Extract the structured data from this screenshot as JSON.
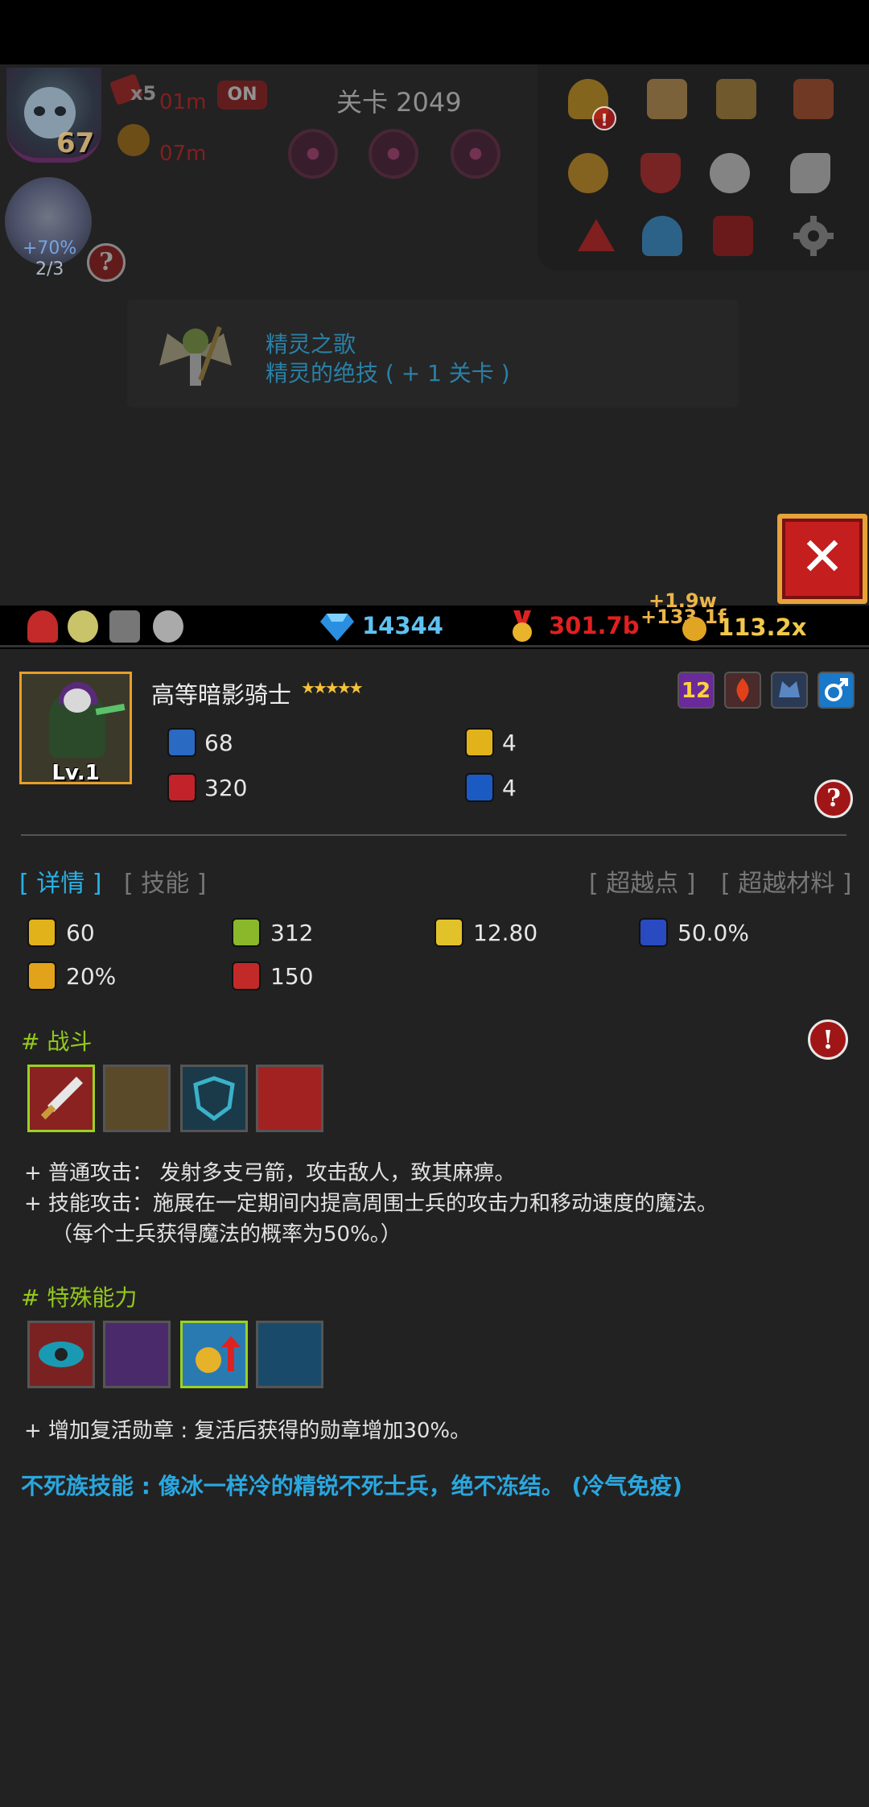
{
  "hud": {
    "hero_level": "67",
    "pet_bonus": "+70%",
    "pet_count": "2/3",
    "multiplier_badge": "x5",
    "timer_1": "01m",
    "timer_2": "07m",
    "on_label": "ON",
    "stage_label": "关卡 2049",
    "help_glyph": "?",
    "alert_glyph": "!"
  },
  "right_menu": {
    "icons": [
      "trophy-icon",
      "podium-icon",
      "book-icon",
      "scroll-icon",
      "chat-icon",
      "shield-crest-icon",
      "angel-icon",
      "bird-icon",
      "triangle-icon",
      "friends-icon",
      "shrine-icon",
      "gear-icon"
    ]
  },
  "notice": {
    "line1": "精灵之歌",
    "line2": "精灵的绝技 ( + 1 关卡 )"
  },
  "close_glyph": "✕",
  "resources": {
    "gems": "14344",
    "medals": "301.7b",
    "float_1": "+1.9w",
    "float_2": "+133.1f",
    "multiplier": "113.2x"
  },
  "unit": {
    "name": "高等暗影骑士",
    "stars": "★★★★★",
    "level": "Lv.1",
    "tag_number": "12",
    "attack": "68",
    "hp": "320",
    "defense": "4",
    "magic_defense": "4"
  },
  "tabs": {
    "details": "[ 详情 ]",
    "skills": "[ 技能 ]",
    "transcend_points": "[ 超越点 ]",
    "transcend_materials": "[ 超越材料 ]"
  },
  "stats": {
    "s1": "60",
    "s2": "312",
    "s3": "12.80",
    "s4": "50.0%",
    "s5": "20%",
    "s6": "150"
  },
  "combat": {
    "title": "# 战斗",
    "desc1": "+ 普通攻击： 发射多支弓箭，攻击敌人，致其麻痹。",
    "desc2": "+ 技能攻击：施展在一定期间内提高周围士兵的攻击力和移动速度的魔法。",
    "desc3": "（每个士兵获得魔法的概率为50%。）"
  },
  "special": {
    "title": "# 特殊能力",
    "desc1": "+ 增加复活勋章 : 复活后获得的勋章增加30%。"
  },
  "undead_skill": "不死族技能 : 像冰一样冷的精锐不死士兵，绝不冻结。 (冷气免疫)",
  "colors": {
    "accent_blue": "#29b1e6",
    "section_green": "#94c81c",
    "gem_blue": "#5ec2f2",
    "medal_red": "#e21f1f",
    "close_red": "#c41e1e"
  }
}
